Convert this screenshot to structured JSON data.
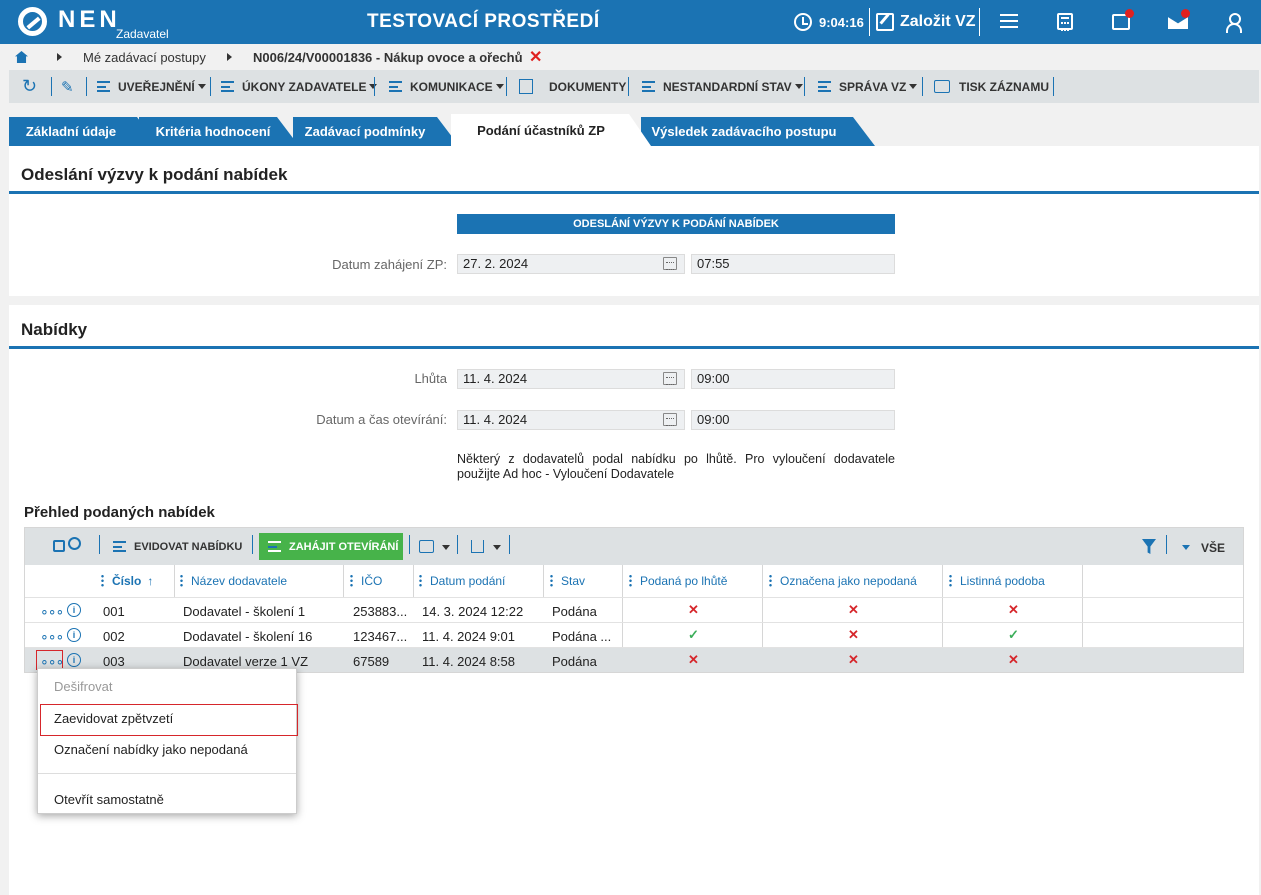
{
  "header": {
    "logo_text": "NEN",
    "logo_sub": "Zadavatel",
    "env_title": "TESTOVACÍ PROSTŘEDÍ",
    "clock": "9:04:16",
    "create_label": "Založit VZ"
  },
  "breadcrumb": {
    "item1": "Mé zadávací postupy",
    "item2": "N006/24/V00001836 - Nákup ovoce a ořechů"
  },
  "toolbar": {
    "publish": "UVEŘEJNĚNÍ",
    "actions": "ÚKONY ZADAVATELE",
    "communication": "KOMUNIKACE",
    "documents": "DOKUMENTY",
    "nonstandard": "NESTANDARDNÍ STAV",
    "management": "SPRÁVA VZ",
    "print": "TISK ZÁZNAMU"
  },
  "tabs": [
    {
      "label": "Základní údaje"
    },
    {
      "label": "Kritéria hodnocení"
    },
    {
      "label": "Zadávací podmínky"
    },
    {
      "label": "Podání účastníků ZP"
    },
    {
      "label": "Výsledek zadávacího postupu"
    }
  ],
  "section1": {
    "title": "Odeslání výzvy k podání nabídek",
    "bar_title": "ODESLÁNÍ VÝZVY K PODÁNÍ NABÍDEK",
    "start_label": "Datum zahájení ZP:",
    "start_date": "27. 2. 2024",
    "start_time": "07:55"
  },
  "section2": {
    "title": "Nabídky",
    "deadline_label": "Lhůta",
    "deadline_date": "11. 4. 2024",
    "deadline_time": "09:00",
    "opening_label": "Datum a čas otevírání:",
    "opening_date": "11. 4. 2024",
    "opening_time": "09:00",
    "note_line1": "Některý z dodavatelů podal nabídku po lhůtě. Pro vyloučení dodavatele",
    "note_line2": "použijte Ad hoc - Vyloučení Dodavatele",
    "overview_title": "Přehled podaných nabídek"
  },
  "grid": {
    "register_offer": "EVIDOVAT NABÍDKU",
    "start_opening": "ZAHÁJIT OTEVÍRÁNÍ",
    "all_label": "VŠE",
    "columns": {
      "number": "Číslo",
      "supplier": "Název dodavatele",
      "ico": "IČO",
      "submitted": "Datum podání",
      "state": "Stav",
      "on_time": "Podaná po lhůtě",
      "marked": "Označena jako nepodaná",
      "paper": "Listinná podoba"
    },
    "rows": [
      {
        "number": "001",
        "supplier": "Dodavatel - školení 1",
        "ico": "253883...",
        "submitted": "14. 3. 2024 12:22",
        "state": "Podána",
        "on_time": "x",
        "marked": "x",
        "paper": "x"
      },
      {
        "number": "002",
        "supplier": "Dodavatel - školení 16",
        "ico": "123467...",
        "submitted": "11. 4. 2024 9:01",
        "state": "Podána ...",
        "on_time": "check",
        "marked": "x",
        "paper": "check"
      },
      {
        "number": "003",
        "supplier": "Dodavatel verze 1 VZ",
        "ico": "67589",
        "submitted": "11. 4. 2024 8:58",
        "state": "Podána",
        "on_time": "x",
        "marked": "x",
        "paper": "x"
      }
    ]
  },
  "context_menu": {
    "items": [
      {
        "label": "Dešifrovat",
        "disabled": true
      },
      {
        "label": "Zaevidovat zpětvzetí",
        "highlighted": true
      },
      {
        "label": "Označení nabídky jako nepodaná"
      },
      {
        "label": "Otevřít samostatně"
      }
    ]
  },
  "colors": {
    "primary": "#1b73b3",
    "green_button": "#47b34a",
    "error": "#d6262b",
    "ok": "#3cae5a"
  }
}
